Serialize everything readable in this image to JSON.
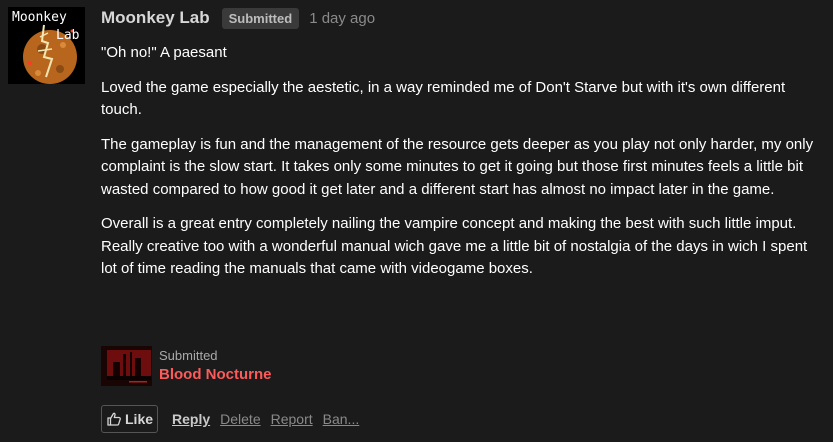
{
  "avatar": {
    "logo_line1": "Moonkey",
    "logo_line2": "Lab"
  },
  "comment": {
    "author": "Moonkey Lab",
    "badge": "Submitted",
    "time": "1 day ago",
    "paragraphs": [
      "\"Oh no!\" A paesant",
      "Loved the game especially the aestetic, in a way reminded me of Don't Starve but with it's own different touch.",
      "The gameplay is fun and the management of the resource gets deeper as you play not only harder, my only complaint is the slow start. It takes only some minutes to get it going but those first minutes feels a little bit wasted compared to how good it get later and a different start has almost no impact later in the game.",
      "Overall is a great entry completely nailing the vampire concept and making the best with such little imput. Really creative too with a wonderful manual wich gave me a little bit of nostalgia of the days in wich I spent lot of time reading the manuals that came with videogame boxes."
    ]
  },
  "submission": {
    "label": "Submitted",
    "title": "Blood Nocturne"
  },
  "actions": {
    "like": "Like",
    "reply": "Reply",
    "delete": "Delete",
    "report": "Report",
    "ban": "Ban..."
  },
  "colors": {
    "background": "#1b1b1b",
    "link_red": "#ff5a5a",
    "muted": "#8a8a8a"
  },
  "icons": {
    "like": "thumbs-up-icon"
  }
}
